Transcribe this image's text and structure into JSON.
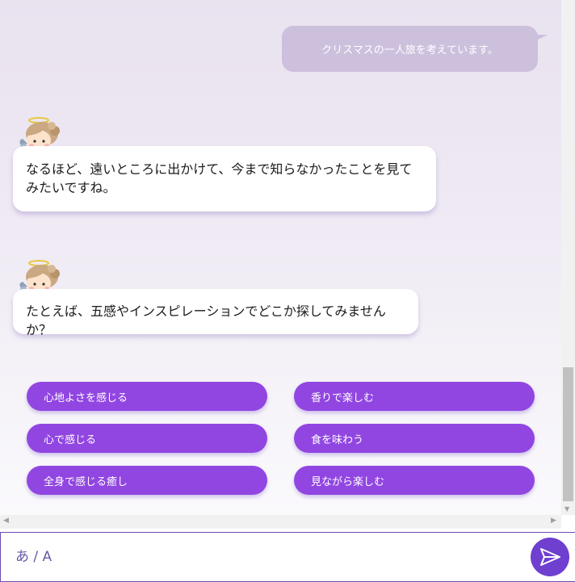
{
  "conversation": {
    "user_message": "クリスマスの一人旅を考えています。",
    "bot_messages": [
      "なるほど、遠いところに出かけて、今まで知らなかったことを見てみたいですね。",
      "たとえば、五感やインスピレーションでどこか探してみませんか？"
    ]
  },
  "options": [
    "心地よさを感じる",
    "香りで楽しむ",
    "心で感じる",
    "食を味わう",
    "全身で感じる癒し",
    "見ながら楽しむ"
  ],
  "input": {
    "placeholder": "あ / A"
  },
  "icons": {
    "avatar": "angel-avatar-icon",
    "send": "send-paper-plane-icon"
  },
  "colors": {
    "option_button": "#9146e1",
    "user_bubble": "#cdc0dd",
    "send_button": "#6f3fd0",
    "input_text": "#6a4db5"
  }
}
